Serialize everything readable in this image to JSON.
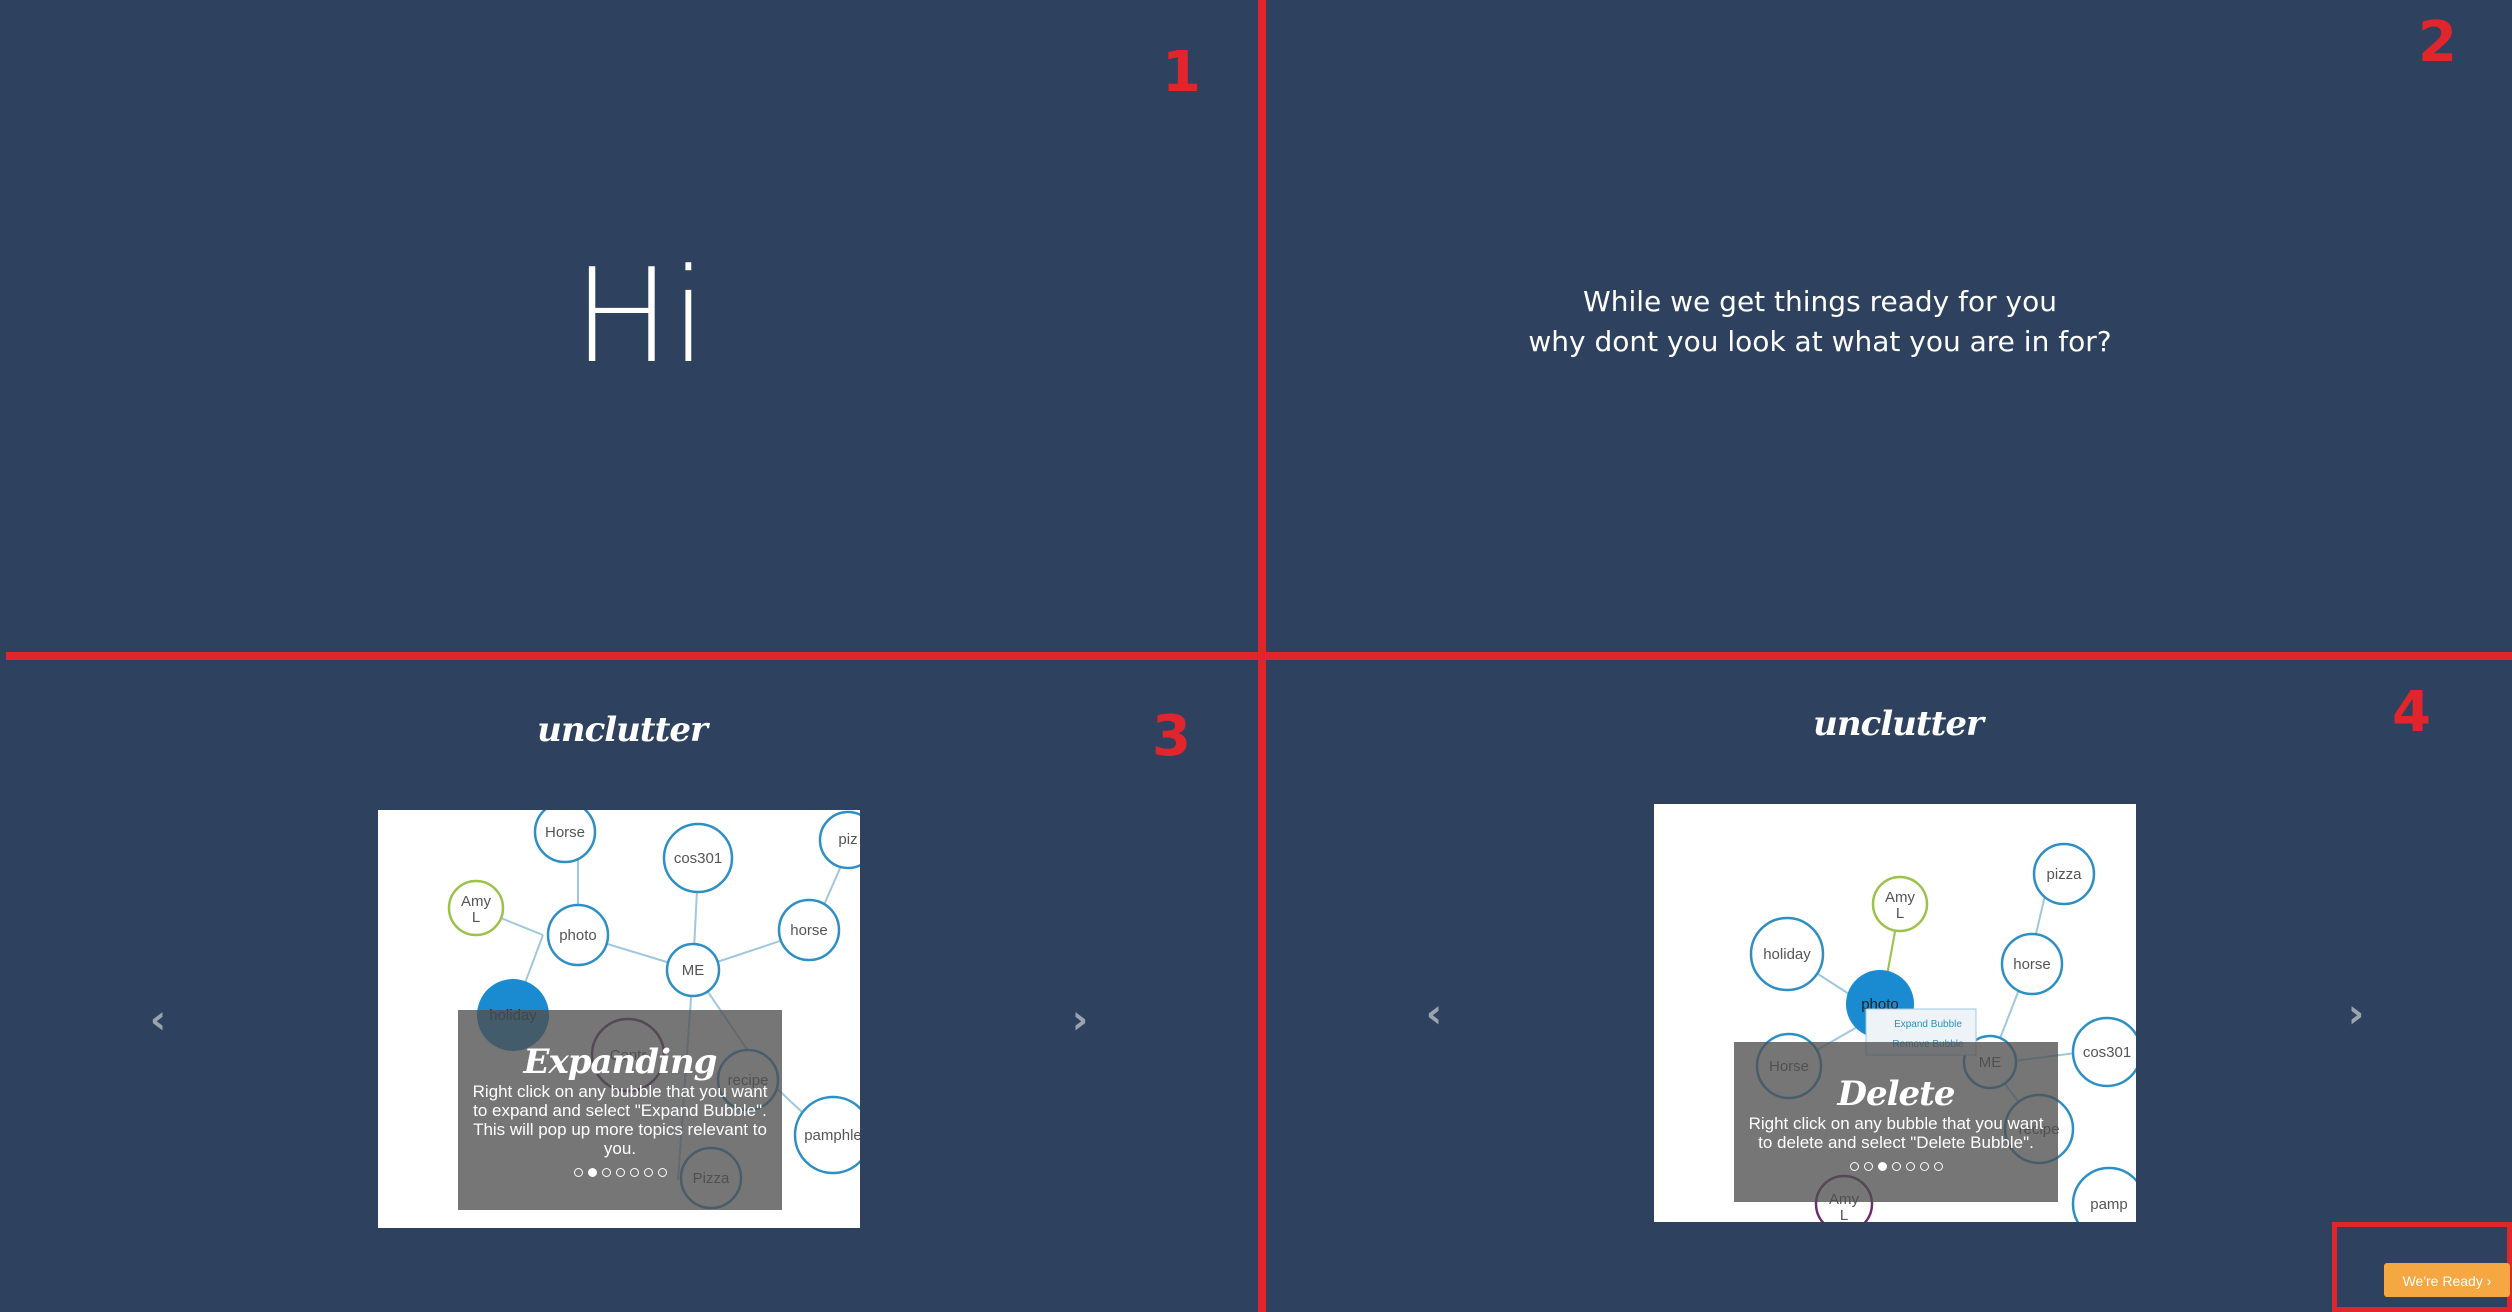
{
  "quadrants": {
    "q1": {
      "number": "1",
      "greeting": "Hi"
    },
    "q2": {
      "number": "2",
      "line1": "While we get things ready for you",
      "line2": "why dont you look at what you are in for?"
    },
    "q3": {
      "number": "3",
      "brand": "unclutter",
      "slide": {
        "title": "Expanding",
        "description": "Right click on any bubble that you want to expand and select \"Expand Bubble\". This will pop up more topics relevant to you.",
        "active_dot": 1,
        "dot_count": 7,
        "bubbles": [
          "Horse",
          "cos301",
          "piz",
          "Amy L",
          "photo",
          "horse",
          "ME",
          "holiday",
          "Contr",
          "recipe",
          "pamphle",
          "Pizza"
        ]
      }
    },
    "q4": {
      "number": "4",
      "brand": "unclutter",
      "slide": {
        "title": "Delete",
        "description": "Right click on any bubble that you want to delete and select \"Delete Bubble\".",
        "active_dot": 2,
        "dot_count": 7,
        "context_menu": [
          "Expand Bubble",
          "Remove Bubble"
        ],
        "bubbles": [
          "pizza",
          "Amy L",
          "holiday",
          "horse",
          "photo",
          "Horse",
          "ME",
          "cos301",
          "recipe",
          "Amy L",
          "pamp"
        ]
      }
    }
  },
  "icons": {
    "prev": "chevron-left-icon",
    "next": "chevron-right-icon"
  },
  "ready_button": {
    "label": "We're Ready",
    "icon": "chevron-right-icon"
  },
  "colors": {
    "background": "#2e415e",
    "annotation": "#e0262c",
    "bubble": "#2d8fc4",
    "button": "#f5a742"
  }
}
